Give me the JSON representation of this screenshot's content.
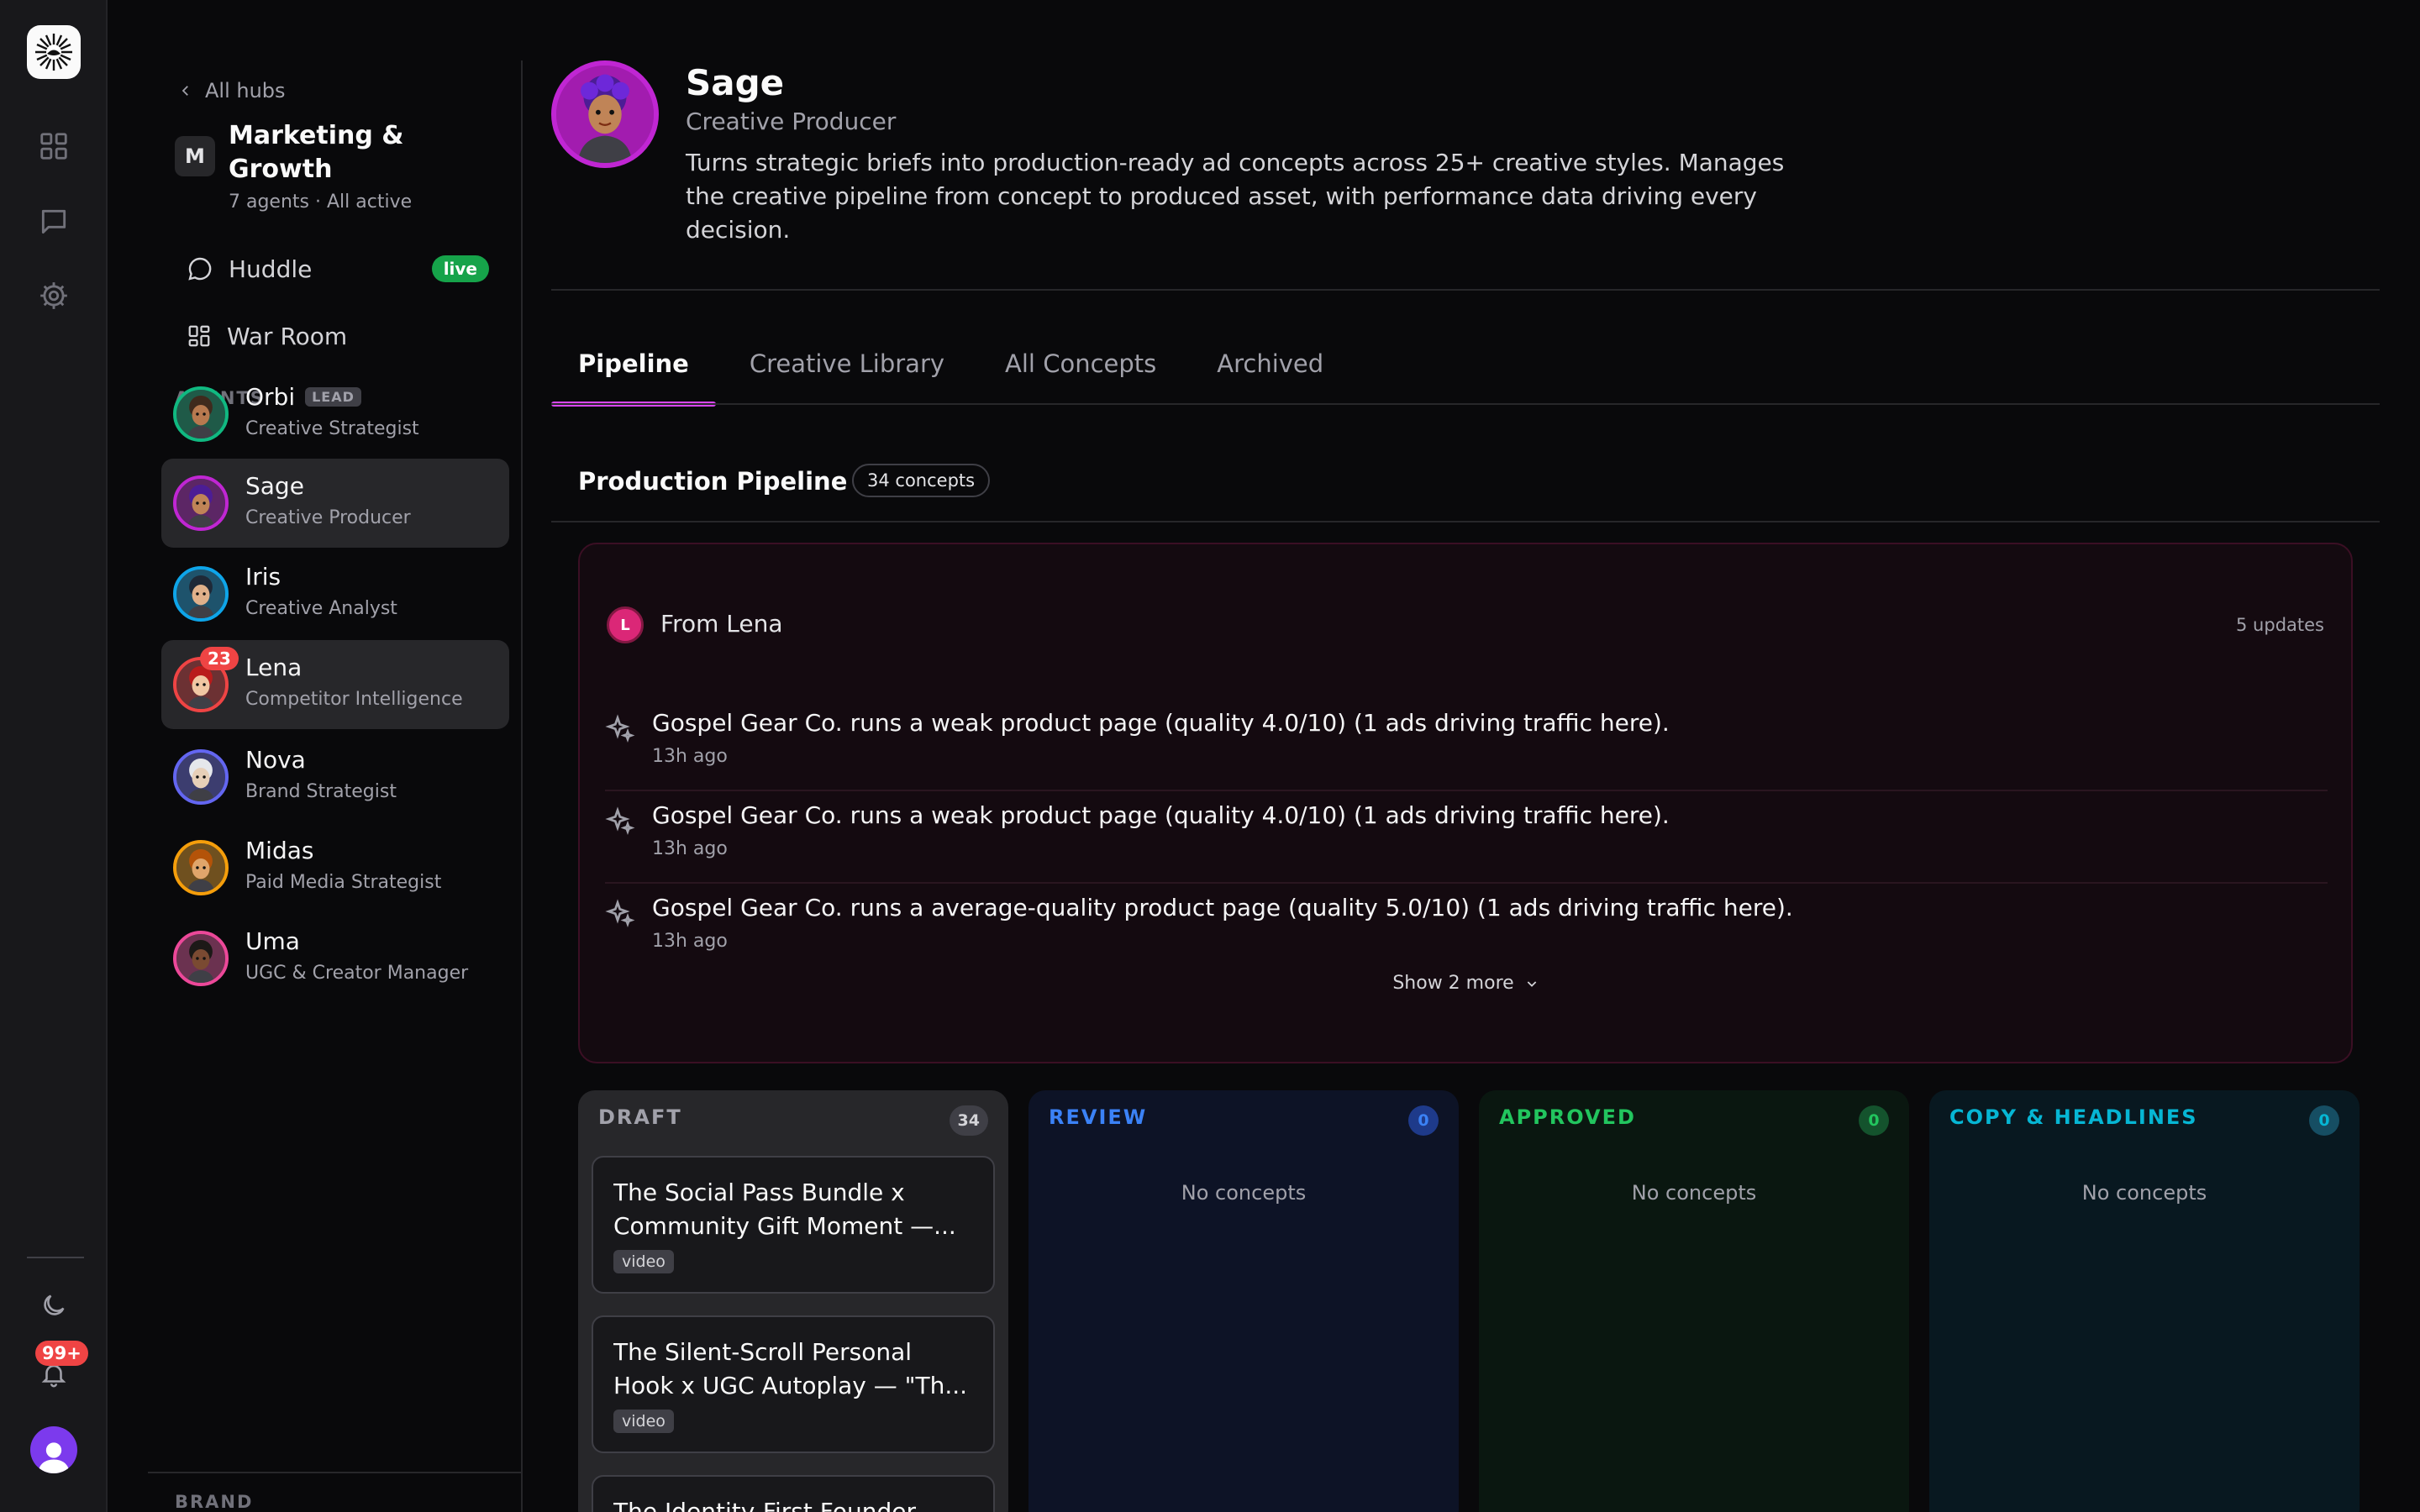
{
  "rail": {
    "notifications_badge": "99+"
  },
  "hub": {
    "back_label": "All hubs",
    "mark": "M",
    "title": "Marketing & Growth",
    "subtitle": "7 agents · All active",
    "nav": [
      {
        "label": "Huddle",
        "badge": "live"
      },
      {
        "label": "War Room"
      }
    ],
    "agents_label": "AGENTS",
    "lead_tag": "LEAD",
    "agents": [
      {
        "name": "Orbi",
        "role": "Creative Strategist",
        "ring": "#10b981"
      },
      {
        "name": "Sage",
        "role": "Creative Producer",
        "ring": "#c026d3"
      },
      {
        "name": "Iris",
        "role": "Creative Analyst",
        "ring": "#0ea5e9"
      },
      {
        "name": "Lena",
        "role": "Competitor Intelligence",
        "ring": "#ef4444",
        "badge": "23"
      },
      {
        "name": "Nova",
        "role": "Brand Strategist",
        "ring": "#6366f1"
      },
      {
        "name": "Midas",
        "role": "Paid Media Strategist",
        "ring": "#f59e0b"
      },
      {
        "name": "Uma",
        "role": "UGC & Creator Manager",
        "ring": "#ec4899"
      }
    ],
    "footer_label": "BRAND"
  },
  "profile": {
    "name": "Sage",
    "role": "Creative Producer",
    "description": "Turns strategic briefs into production-ready ad concepts across 25+ creative styles. Manages the creative pipeline from concept to produced asset, with performance data driving every decision."
  },
  "tabs": [
    "Pipeline",
    "Creative Library",
    "All Concepts",
    "Archived"
  ],
  "pipeline": {
    "title": "Production Pipeline",
    "count_label": "34 concepts"
  },
  "updates": {
    "avatar_letter": "L",
    "from": "From Lena",
    "count_label": "5 updates",
    "items": [
      {
        "text": "Gospel Gear Co. runs a weak product page (quality 4.0/10) (1 ads driving traffic here).",
        "time": "13h ago"
      },
      {
        "text": "Gospel Gear Co. runs a weak product page (quality 4.0/10) (1 ads driving traffic here).",
        "time": "13h ago"
      },
      {
        "text": "Gospel Gear Co. runs a average-quality product page (quality 5.0/10) (1 ads driving traffic here).",
        "time": "13h ago"
      }
    ],
    "show_more": "Show 2 more"
  },
  "columns": [
    {
      "title": "DRAFT",
      "count": "34",
      "color": "#a1a1aa",
      "bg": "#27272a",
      "count_bg": "#3f3f46",
      "cards": [
        {
          "title": "The Social Pass Bundle x Community Gift Moment —...",
          "tag": "video"
        },
        {
          "title": "The Silent-Scroll Personal Hook x UGC Autoplay — \"Th...",
          "tag": "video"
        },
        {
          "title": "The Identity-First Founder"
        }
      ]
    },
    {
      "title": "REVIEW",
      "count": "0",
      "color": "#3b82f6",
      "bg": "#0d1326",
      "count_bg": "#1e3a8a",
      "empty": "No concepts"
    },
    {
      "title": "APPROVED",
      "count": "0",
      "color": "#22c55e",
      "bg": "#0a1710",
      "count_bg": "#14532d",
      "empty": "No concepts"
    },
    {
      "title": "COPY & HEADLINES",
      "count": "0",
      "color": "#06b6d4",
      "bg": "#081820",
      "count_bg": "#164e63",
      "empty": "No concepts"
    }
  ]
}
